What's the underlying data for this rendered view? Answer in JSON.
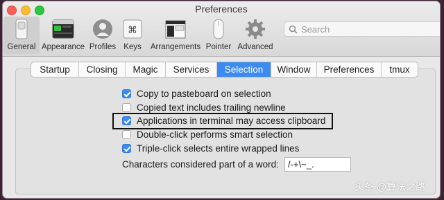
{
  "window": {
    "title": "Preferences"
  },
  "toolbar": {
    "items": [
      {
        "label": "General",
        "icon": "switch-icon",
        "selected": true
      },
      {
        "label": "Appearance",
        "icon": "terminal-window-icon",
        "selected": false
      },
      {
        "label": "Profiles",
        "icon": "user-silhouette-icon",
        "selected": false
      },
      {
        "label": "Keys",
        "icon": "command-key-icon",
        "selected": false
      },
      {
        "label": "Arrangements",
        "icon": "window-arrangement-icon",
        "selected": false
      },
      {
        "label": "Pointer",
        "icon": "mouse-icon",
        "selected": false
      },
      {
        "label": "Advanced",
        "icon": "gear-icon",
        "selected": false
      }
    ]
  },
  "search": {
    "placeholder": "Search"
  },
  "tabs": [
    {
      "label": "Startup",
      "active": false
    },
    {
      "label": "Closing",
      "active": false
    },
    {
      "label": "Magic",
      "active": false
    },
    {
      "label": "Services",
      "active": false
    },
    {
      "label": "Selection",
      "active": true
    },
    {
      "label": "Window",
      "active": false
    },
    {
      "label": "Preferences",
      "active": false
    },
    {
      "label": "tmux",
      "active": false
    }
  ],
  "options": [
    {
      "label": "Copy to pasteboard on selection",
      "checked": true
    },
    {
      "label": "Copied text includes trailing newline",
      "checked": false
    },
    {
      "label": "Applications in terminal may access clipboard",
      "checked": true
    },
    {
      "label": "Double-click performs smart selection",
      "checked": false
    },
    {
      "label": "Triple-click selects entire wrapped lines",
      "checked": true
    }
  ],
  "word_chars": {
    "label": "Characters considered part of a word:",
    "value": "/-+\\~_."
  },
  "watermark": "头条 @算法之路",
  "colors": {
    "accent": "#3d8bf0",
    "desktop": "#3b2433"
  }
}
